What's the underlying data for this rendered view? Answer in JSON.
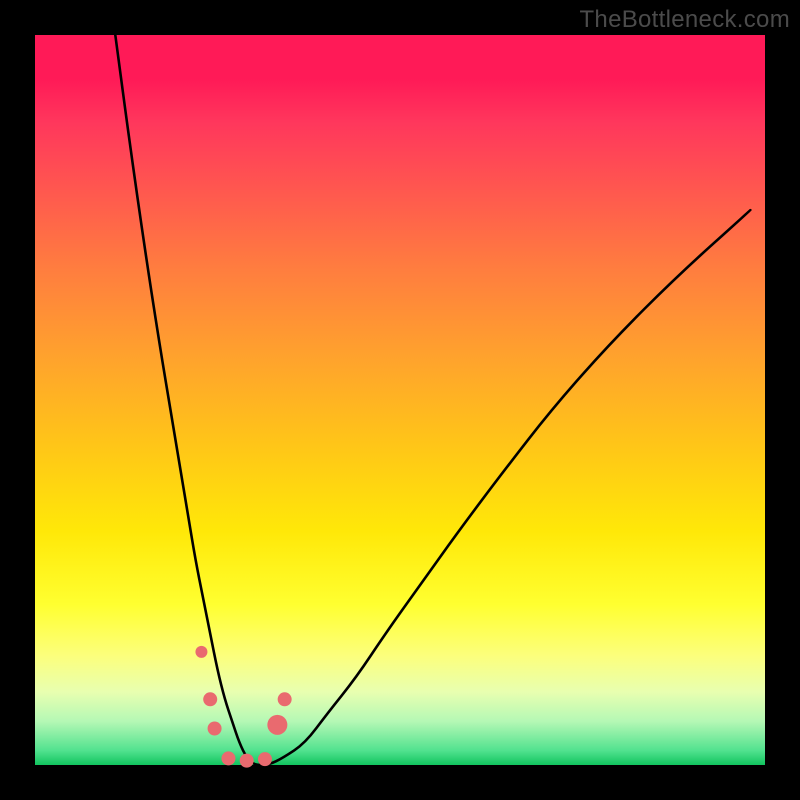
{
  "watermark": "TheBottleneck.com",
  "chart_data": {
    "type": "line",
    "title": "",
    "xlabel": "",
    "ylabel": "",
    "xlim": [
      0,
      100
    ],
    "ylim": [
      0,
      100
    ],
    "series": [
      {
        "name": "bottleneck-curve",
        "x": [
          11,
          13,
          15,
          17,
          19,
          20,
          21,
          22,
          23,
          24,
          25,
          26,
          27,
          28,
          29,
          30,
          32,
          34,
          37,
          40,
          44,
          48,
          53,
          58,
          64,
          71,
          79,
          88,
          98
        ],
        "values": [
          100,
          85,
          71,
          58,
          46,
          40,
          34,
          28,
          23,
          18,
          13,
          9,
          6,
          3,
          1,
          0,
          0,
          1,
          3,
          7,
          12,
          18,
          25,
          32,
          40,
          49,
          58,
          67,
          76
        ]
      }
    ],
    "markers": {
      "name": "highlight-points",
      "color": "#e96a6f",
      "points": [
        {
          "x": 22.8,
          "y": 15.5,
          "r": 6
        },
        {
          "x": 24.0,
          "y": 9.0,
          "r": 7
        },
        {
          "x": 24.6,
          "y": 5.0,
          "r": 7
        },
        {
          "x": 26.5,
          "y": 0.9,
          "r": 7
        },
        {
          "x": 29.0,
          "y": 0.6,
          "r": 7
        },
        {
          "x": 31.5,
          "y": 0.8,
          "r": 7
        },
        {
          "x": 33.2,
          "y": 5.5,
          "r": 10
        },
        {
          "x": 34.2,
          "y": 9.0,
          "r": 7
        }
      ]
    },
    "colors": {
      "curve": "#000000",
      "marker": "#e96a6f",
      "gradient_top": "#ff1a57",
      "gradient_bottom": "#12c45f",
      "frame": "#000000"
    }
  }
}
